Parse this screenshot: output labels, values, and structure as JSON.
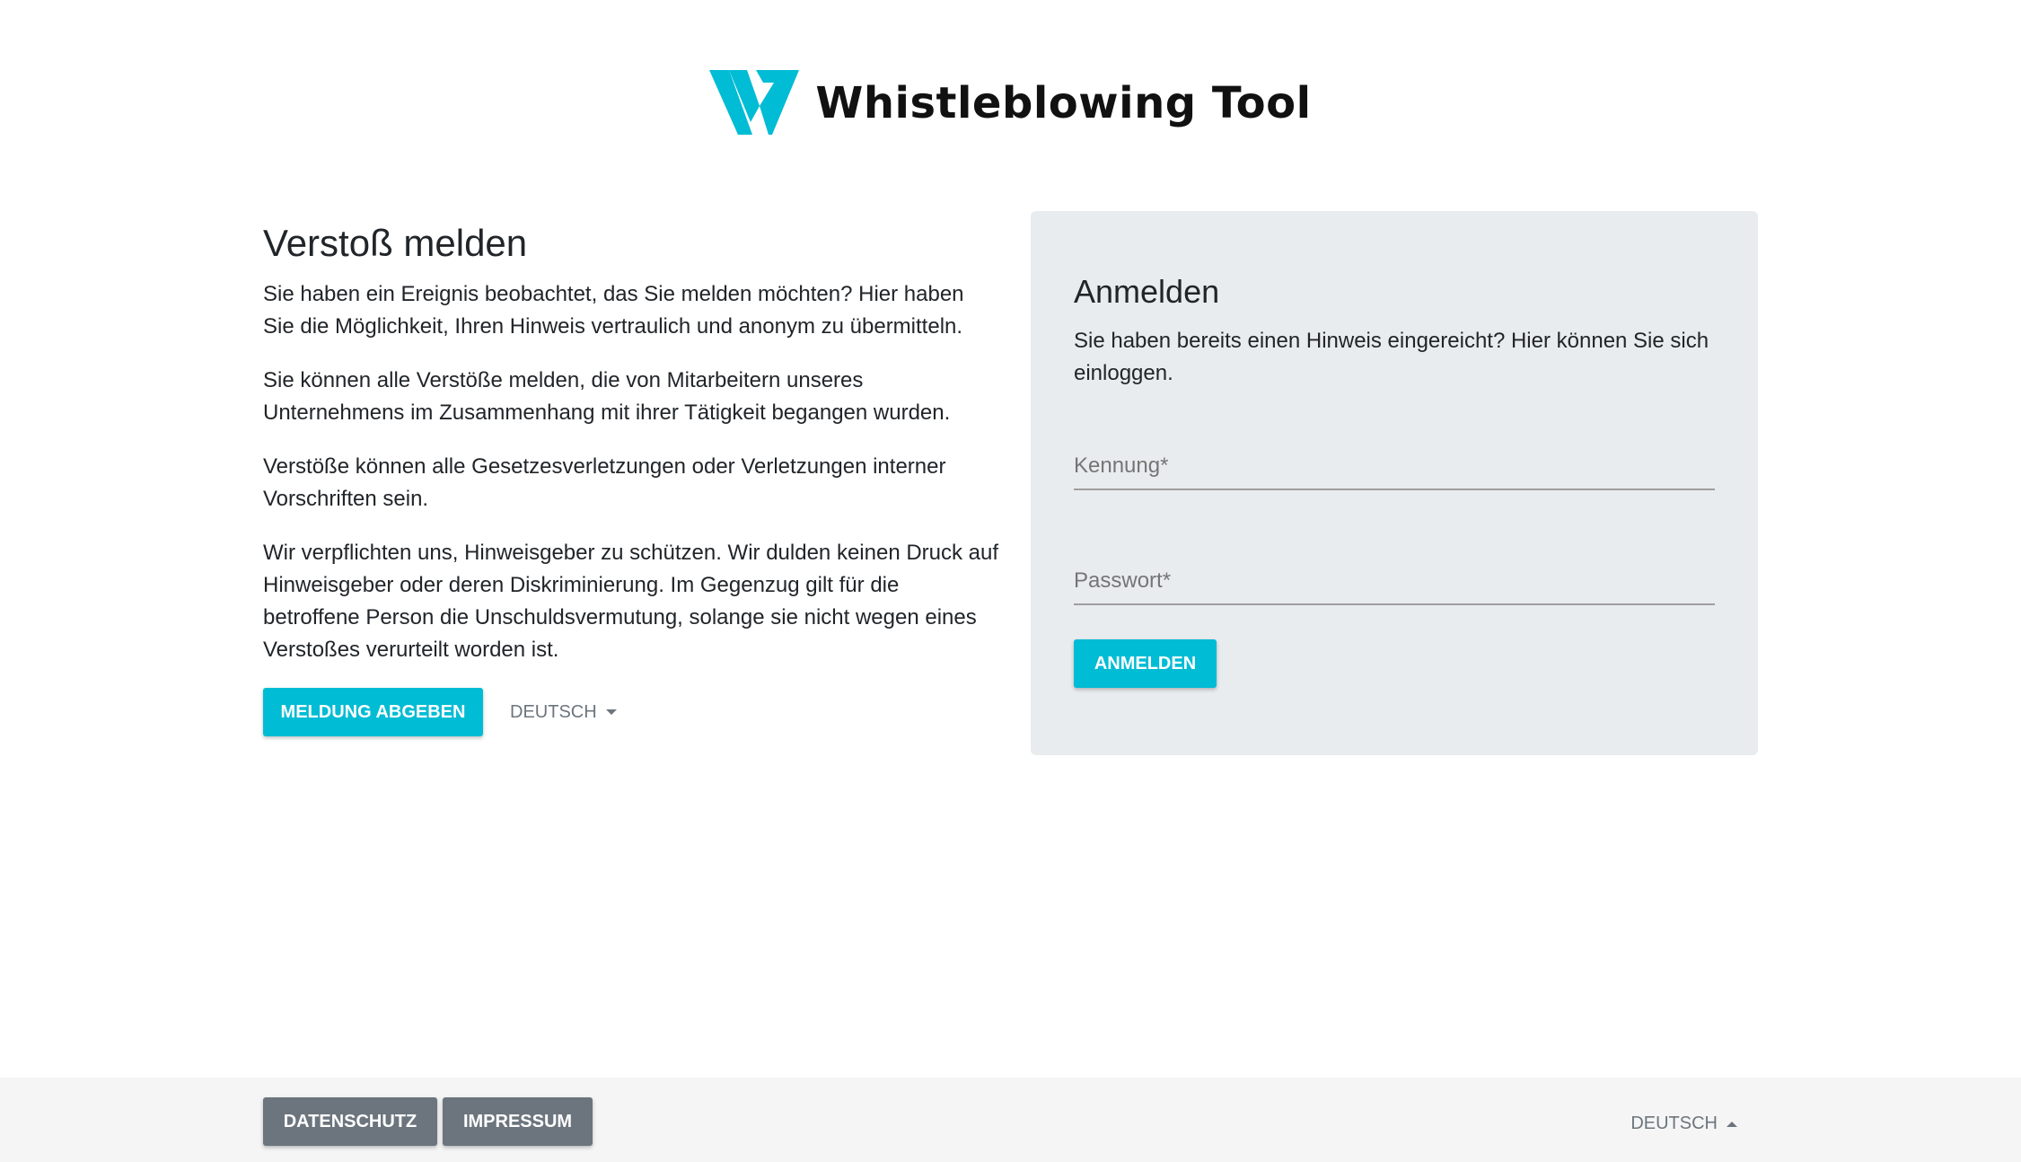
{
  "header": {
    "logo_icon": "whistleblowing-w-logo",
    "app_name": "Whistleblowing Tool",
    "brand_color": "#00bcd4"
  },
  "report": {
    "title": "Verstoß melden",
    "paragraphs": [
      "Sie haben ein Ereignis beobachtet, das Sie melden möchten? Hier haben Sie die Möglichkeit, Ihren Hinweis vertraulich und anonym zu übermitteln.",
      "Sie können alle Verstöße melden, die von Mitarbeitern unseres Unternehmens im Zusammenhang mit ihrer Tätigkeit begangen wurden.",
      "Verstöße können alle Gesetzesverletzungen oder Verletzungen interner Vorschriften sein.",
      "Wir verpflichten uns, Hinweisgeber zu schützen. Wir dulden keinen Druck auf Hinweisgeber oder deren Diskriminierung. Im Gegenzug gilt für die betroffene Person die Unschuldsvermutung, solange sie nicht wegen eines Verstoßes verurteilt worden ist."
    ],
    "submit_label": "MELDUNG ABGEBEN",
    "language_label": "DEUTSCH"
  },
  "login": {
    "title": "Anmelden",
    "description": "Sie haben bereits einen Hinweis eingereicht? Hier können Sie sich einloggen.",
    "id_placeholder": "Kennung*",
    "password_placeholder": "Passwort*",
    "login_label": "ANMELDEN",
    "card_color": "#e9ecef"
  },
  "footer": {
    "privacy_label": "DATENSCHUTZ",
    "imprint_label": "IMPRESSUM",
    "language_label": "DEUTSCH",
    "button_color": "#6c757d"
  }
}
